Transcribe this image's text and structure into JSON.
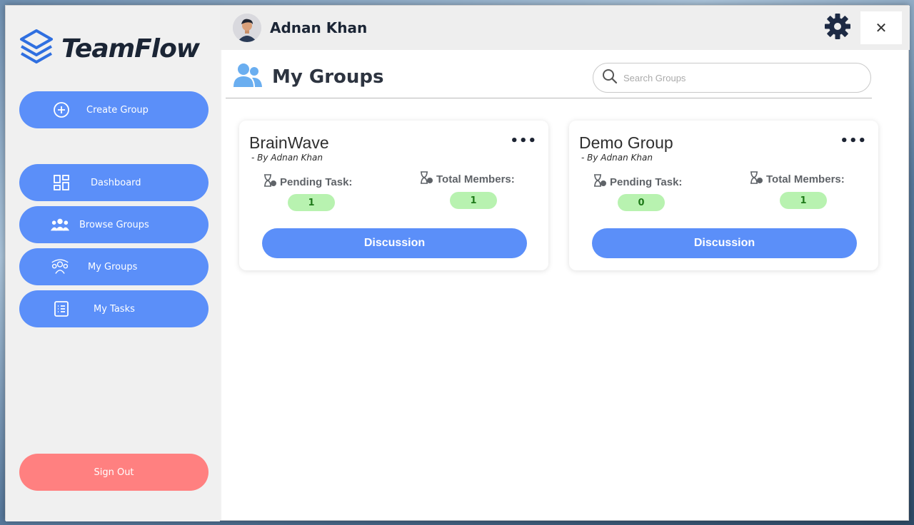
{
  "app": {
    "name": "TeamFlow"
  },
  "user": {
    "name": "Adnan Khan"
  },
  "sidebar": {
    "create_label": "Create Group",
    "items": [
      {
        "label": "Dashboard",
        "icon": "dashboard-icon"
      },
      {
        "label": "Browse Groups",
        "icon": "users-icon"
      },
      {
        "label": "My Groups",
        "icon": "group-icon"
      },
      {
        "label": "My Tasks",
        "icon": "list-icon"
      }
    ],
    "signout_label": "Sign Out"
  },
  "topbar": {
    "close_symbol": "✕"
  },
  "page": {
    "title": "My Groups",
    "search_placeholder": "Search Groups"
  },
  "groups": [
    {
      "name": "BrainWave",
      "by": "- By Adnan Khan",
      "pending_label": "Pending Task:",
      "pending_value": "1",
      "members_label": "Total Members:",
      "members_value": "1",
      "button_label": "Discussion",
      "menu_symbol": "•••"
    },
    {
      "name": "Demo Group",
      "by": "- By Adnan Khan",
      "pending_label": "Pending Task:",
      "pending_value": "0",
      "members_label": "Total Members:",
      "members_value": "1",
      "button_label": "Discussion",
      "menu_symbol": "•••"
    }
  ],
  "colors": {
    "accent": "#5b8ff9",
    "signout": "#ff8080",
    "pill_bg": "#b8f2b0",
    "pill_text": "#1f7a1a"
  }
}
